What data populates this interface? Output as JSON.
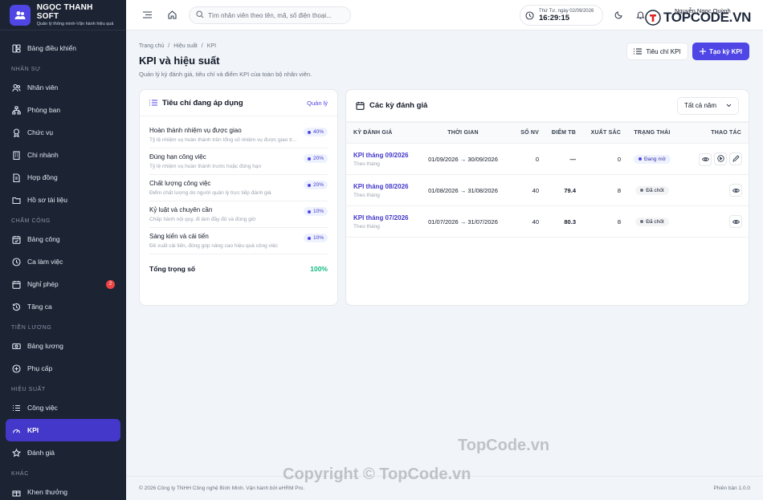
{
  "brand": {
    "name": "NGỌC THANH SOFT",
    "tagline": "Quản lý thông minh-Vận hành hiệu quả"
  },
  "sidebar": {
    "dashboard": "Bảng điều khiển",
    "sections": {
      "hr": "NHÂN SỰ",
      "attendance": "CHẤM CÔNG",
      "payroll": "TIỀN LƯƠNG",
      "performance": "HIỆU SUẤT",
      "other": "KHÁC"
    },
    "items": {
      "employees": "Nhân viên",
      "departments": "Phòng ban",
      "positions": "Chức vụ",
      "branches": "Chi nhánh",
      "contracts": "Hợp đồng",
      "documents": "Hồ sơ tài liệu",
      "timesheet": "Bảng công",
      "shifts": "Ca làm việc",
      "leave": "Nghỉ phép",
      "leave_badge": "2",
      "extra_shift": "Tăng ca",
      "salary": "Bảng lương",
      "allowance": "Phụ cấp",
      "tasks": "Công việc",
      "kpi": "KPI",
      "evaluation": "Đánh giá",
      "rewards": "Khen thưởng"
    }
  },
  "topbar": {
    "search_placeholder": "Tìm nhân viên theo tên, mã, số điện thoại...",
    "date": "Thứ Tư, ngày 02/09/2026",
    "time": "16:29:15",
    "user_name": "Nguyễn Ngọc Quỳnh"
  },
  "watermark": {
    "brand": "TOPCODE",
    "suffix": ".VN",
    "line1": "TopCode.vn",
    "line2": "Copyright © TopCode.vn"
  },
  "page": {
    "breadcrumb": [
      "Trang chủ",
      "Hiệu suất",
      "KPI"
    ],
    "title": "KPI và hiệu suất",
    "subtitle": "Quản lý kỳ đánh giá, tiêu chí và điểm KPI của toàn bộ nhân viên.",
    "btn_criteria": "Tiêu chí KPI",
    "btn_create": "Tạo kỳ KPI"
  },
  "criteria": {
    "title": "Tiêu chí đang áp dụng",
    "manage": "Quản lý",
    "items": [
      {
        "name": "Hoàn thành nhiệm vụ được giao",
        "desc": "Tỷ lệ nhiệm vụ hoàn thành trên tổng số nhiệm vụ được giao tr...",
        "weight": "40%"
      },
      {
        "name": "Đúng hạn công việc",
        "desc": "Tỷ lệ nhiệm vụ hoàn thành trước hoặc đúng hạn",
        "weight": "20%"
      },
      {
        "name": "Chất lượng công việc",
        "desc": "Điểm chất lượng do người quản lý trực tiếp đánh giá",
        "weight": "20%"
      },
      {
        "name": "Kỷ luật và chuyên cần",
        "desc": "Chấp hành nội quy, đi làm đầy đủ và đúng giờ",
        "weight": "10%"
      },
      {
        "name": "Sáng kiến và cải tiến",
        "desc": "Đề xuất cải tiến, đóng góp nâng cao hiệu quả công việc",
        "weight": "10%"
      }
    ],
    "total_label": "Tổng trọng số",
    "total_value": "100%"
  },
  "periods": {
    "title": "Các kỳ đánh giá",
    "filter": "Tất cả năm",
    "columns": [
      "KỲ ĐÁNH GIÁ",
      "THỜI GIAN",
      "SỐ NV",
      "ĐIỂM TB",
      "XUẤT SẮC",
      "TRẠNG THÁI",
      "THAO TÁC"
    ],
    "rows": [
      {
        "name": "KPI tháng 09/2026",
        "type": "Theo tháng",
        "range": "01/09/2026 → 30/09/2026",
        "count": "0",
        "avg": "—",
        "excellent": "0",
        "status": "Đang mở",
        "status_kind": "open"
      },
      {
        "name": "KPI tháng 08/2026",
        "type": "Theo tháng",
        "range": "01/08/2026 → 31/08/2026",
        "count": "40",
        "avg": "79.4",
        "excellent": "8",
        "status": "Đã chốt",
        "status_kind": "closed"
      },
      {
        "name": "KPI tháng 07/2026",
        "type": "Theo tháng",
        "range": "01/07/2026 → 31/07/2026",
        "count": "40",
        "avg": "80.3",
        "excellent": "8",
        "status": "Đã chốt",
        "status_kind": "closed"
      }
    ]
  },
  "footer": {
    "copyright": "© 2026 Công ty TNHH Công nghệ Bình Minh. Vận hành bởi eHRM Pro.",
    "version": "Phiên bản 1.0.0"
  },
  "colors": {
    "accent": "#4f46e5",
    "sidebar_bg": "#1c2333",
    "success": "#10b981",
    "danger": "#ef4444"
  }
}
